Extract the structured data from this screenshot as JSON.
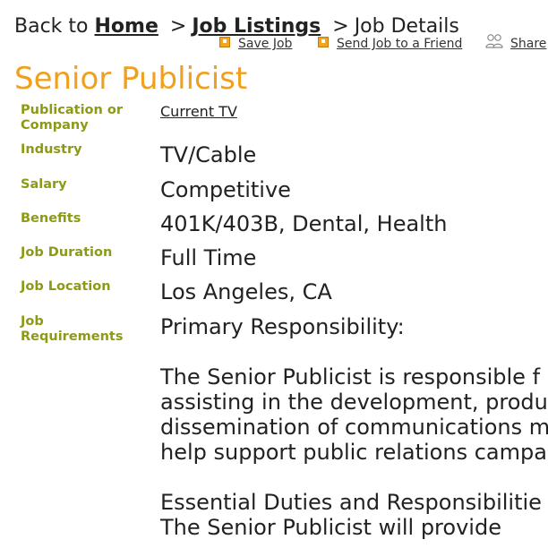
{
  "breadcrumb": {
    "back_to": "Back to",
    "home": "Home",
    "sep1": ">",
    "listings": "Job Listings",
    "sep2": ">",
    "current": "Job Details"
  },
  "actions": {
    "save": "Save Job",
    "send": "Send Job to a Friend",
    "share": "Share"
  },
  "job": {
    "title": "Senior Publicist",
    "fields": {
      "company": {
        "label": "Publication or Company",
        "value": "Current TV"
      },
      "industry": {
        "label": "Industry",
        "value": "TV/Cable"
      },
      "salary": {
        "label": "Salary",
        "value": "Competitive"
      },
      "benefits": {
        "label": "Benefits",
        "value": "401K/403B, Dental, Health"
      },
      "duration": {
        "label": "Job Duration",
        "value": "Full Time"
      },
      "location": {
        "label": "Job Location",
        "value": "Los Angeles, CA"
      },
      "requirements": {
        "label": "Job Requirements",
        "value": "Primary Responsibility:"
      }
    },
    "description": {
      "p1": [
        "The Senior Publicist is responsible f",
        "assisting in the development, produ",
        "dissemination of communications m",
        "help support public relations campa"
      ],
      "p2": [
        "Essential Duties and Responsibilitie",
        "The Senior Publicist will provide"
      ]
    }
  },
  "colors": {
    "title": "#f0a01e",
    "label": "#8c9a16",
    "action_icon": "#f3a51d"
  },
  "icons": {
    "save": "feed-icon",
    "send": "feed-icon",
    "share": "share-people-icon"
  }
}
